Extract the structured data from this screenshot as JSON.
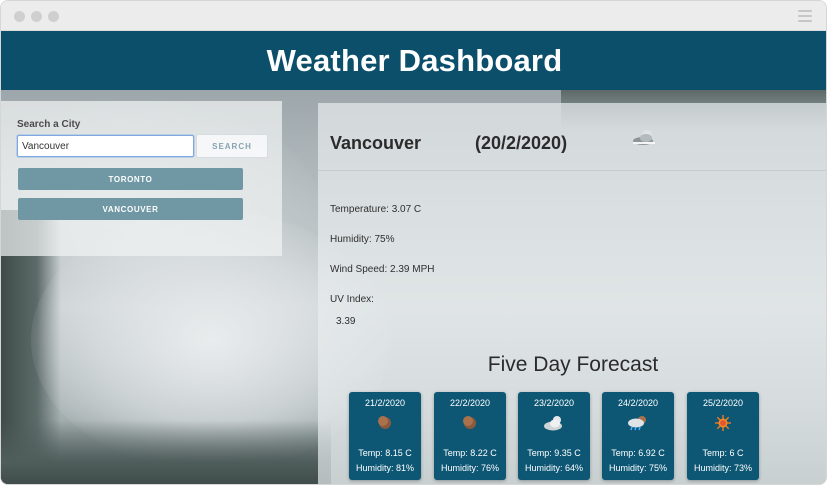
{
  "app": {
    "title": "Weather Dashboard"
  },
  "search": {
    "label": "Search a City",
    "value": "Vancouver",
    "button_label": "SEARCH",
    "history": [
      "TORONTO",
      "VANCOUVER"
    ]
  },
  "current": {
    "city": "Vancouver",
    "date": "(20/2/2020)",
    "icon": "partly-cloudy-icon",
    "temperature": "Temperature: 3.07 C",
    "humidity": "Humidity: 75%",
    "wind": "Wind Speed: 2.39 MPH",
    "uv_label": "UV Index:",
    "uv_value": "3.39"
  },
  "forecast": {
    "title": "Five Day Forecast",
    "days": [
      {
        "date": "21/2/2020",
        "icon": "moon-icon",
        "temp": "Temp: 8.15 C",
        "humidity": "Humidity: 81%"
      },
      {
        "date": "22/2/2020",
        "icon": "moon-icon",
        "temp": "Temp: 8.22 C",
        "humidity": "Humidity: 76%"
      },
      {
        "date": "23/2/2020",
        "icon": "cloud-icon",
        "temp": "Temp: 9.35 C",
        "humidity": "Humidity: 64%"
      },
      {
        "date": "24/2/2020",
        "icon": "rain-cloud-icon",
        "temp": "Temp: 6.92 C",
        "humidity": "Humidity: 75%"
      },
      {
        "date": "25/2/2020",
        "icon": "sun-icon",
        "temp": "Temp: 6 C",
        "humidity": "Humidity: 73%"
      }
    ]
  },
  "colors": {
    "header": "#0b4f6b",
    "card": "#0d5774",
    "history_button": "#6f97a4"
  }
}
